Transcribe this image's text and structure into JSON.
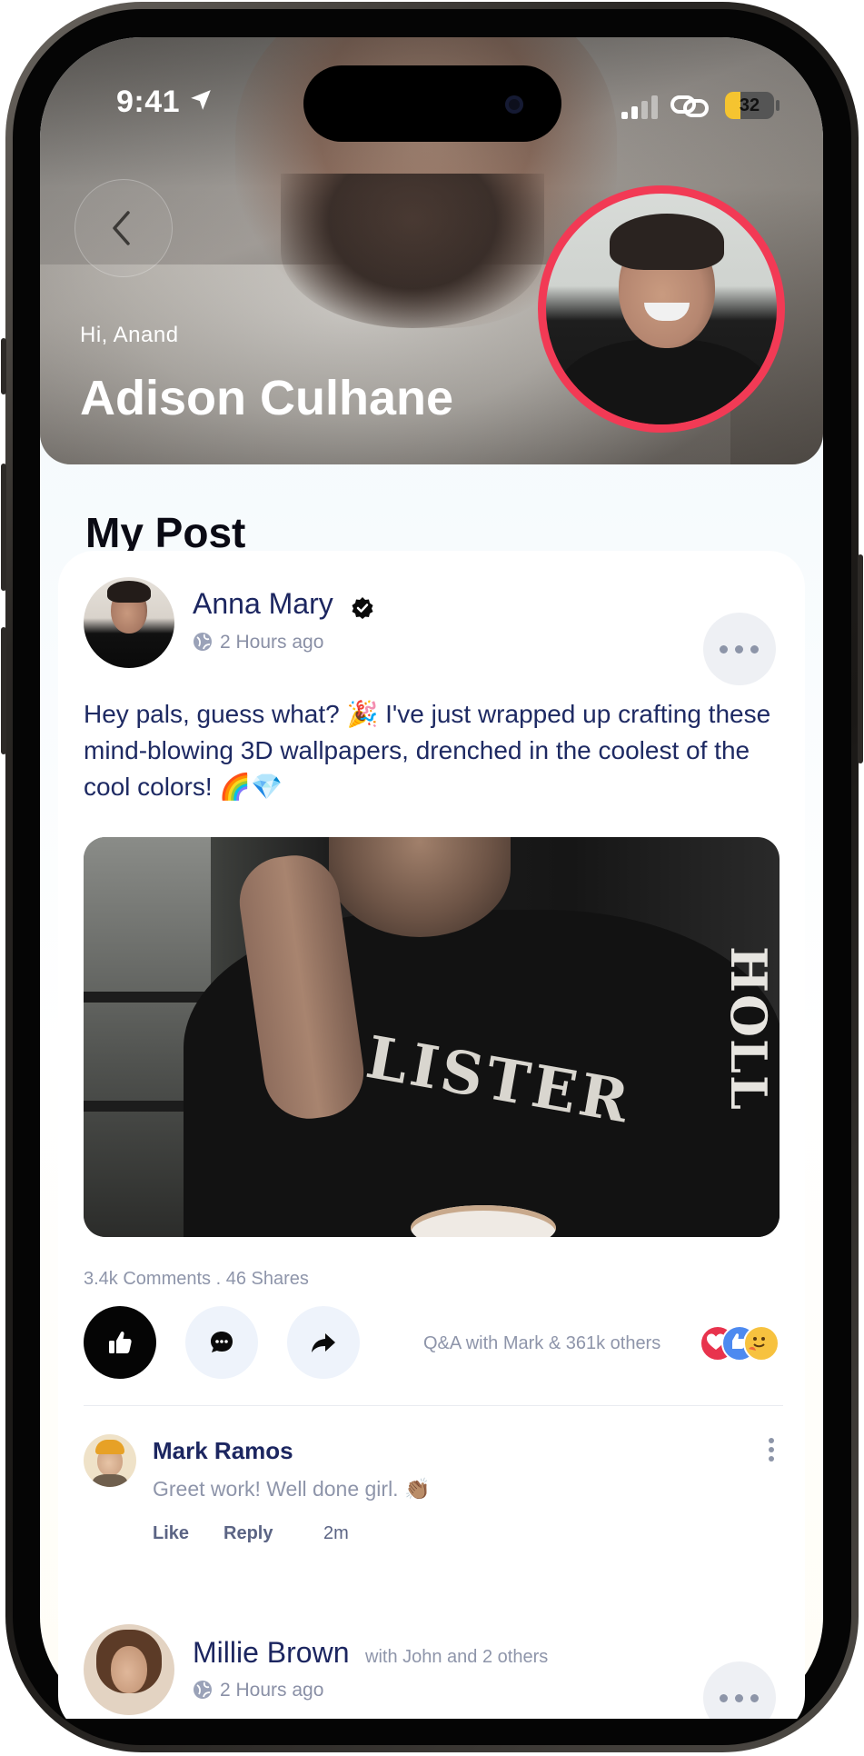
{
  "status_bar": {
    "time": "9:41",
    "battery": "32",
    "battery_level": 0.32
  },
  "header": {
    "greeting": "Hi, Anand",
    "user_name": "Adison Culhane"
  },
  "section_title": "My Post",
  "post": {
    "author": "Anna Mary",
    "time": "2 Hours ago",
    "text": "Hey pals, guess what? 🎉 I've just wrapped up crafting these mind-blowing 3D wallpapers, drenched in the coolest of the cool colors! 🌈💎",
    "stats": "3.4k Comments . 46 Shares",
    "reaction_summary": "Q&A with Mark & 361k others",
    "image_text": "LISTER",
    "image_sleeve_text": "HOLL"
  },
  "comment": {
    "author": "Mark Ramos",
    "text": "Greet work! Well done girl. 👏🏽",
    "like_label": "Like",
    "reply_label": "Reply",
    "time": "2m"
  },
  "next_post": {
    "author": "Millie Brown",
    "with_text": "with John and 2 others",
    "time": "2 Hours ago"
  },
  "colors": {
    "avatar_ring": "#f23a55",
    "name_text": "#1c2660",
    "muted_text": "#8e95aa",
    "like_button": "#050505",
    "action_button_bg": "#eef3fb"
  }
}
